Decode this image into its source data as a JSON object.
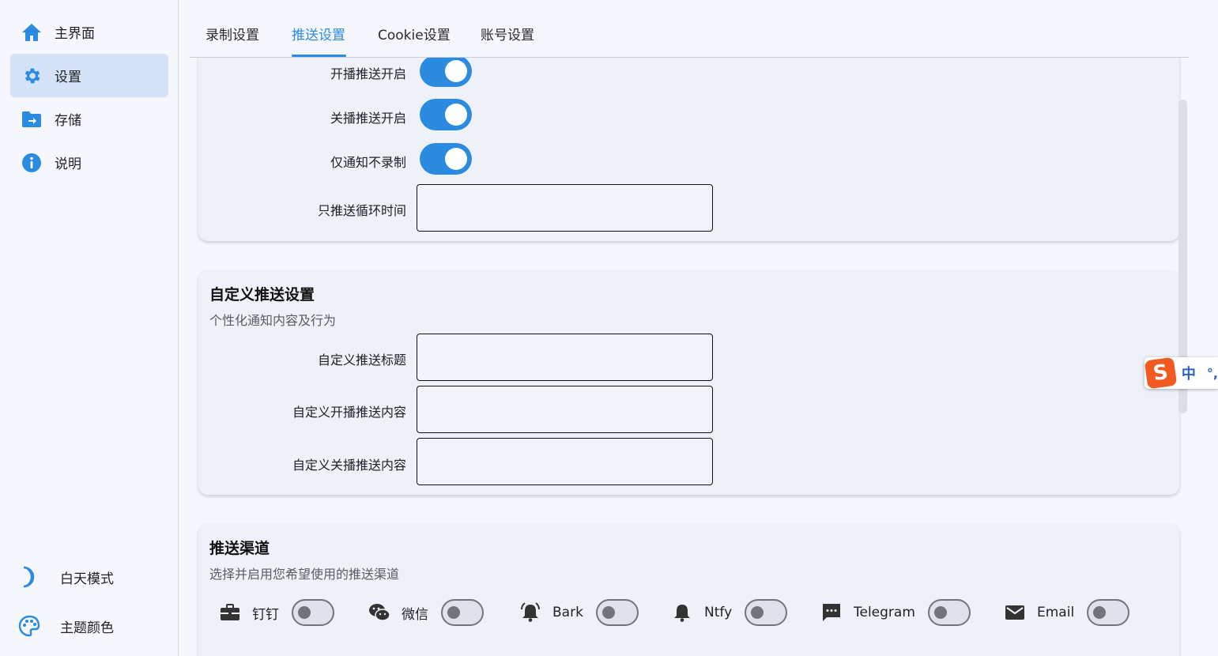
{
  "sidebar": {
    "items": [
      {
        "label": "主界面",
        "icon": "home-icon"
      },
      {
        "label": "设置",
        "icon": "gear-icon"
      },
      {
        "label": "存储",
        "icon": "folder-arrow-icon"
      },
      {
        "label": "说明",
        "icon": "info-icon"
      }
    ],
    "bottom": [
      {
        "label": "白天模式",
        "icon": "moon-icon"
      },
      {
        "label": "主题颜色",
        "icon": "palette-icon"
      }
    ]
  },
  "tabs": [
    "录制设置",
    "推送设置",
    "Cookie设置",
    "账号设置"
  ],
  "push_card": {
    "rows": [
      {
        "label": "开播推送开启",
        "value": true
      },
      {
        "label": "关播推送开启",
        "value": true
      },
      {
        "label": "仅通知不录制",
        "value": true
      }
    ],
    "loop_label": "只推送循环时间",
    "loop_value": ""
  },
  "custom_card": {
    "title": "自定义推送设置",
    "subtitle": "个性化通知内容及行为",
    "fields": [
      {
        "label": "自定义推送标题",
        "value": ""
      },
      {
        "label": "自定义开播推送内容",
        "value": ""
      },
      {
        "label": "自定义关播推送内容",
        "value": ""
      }
    ]
  },
  "channel_card": {
    "title": "推送渠道",
    "subtitle": "选择并启用您希望使用的推送渠道",
    "channels": [
      {
        "label": "钉钉",
        "icon": "briefcase-icon",
        "enabled": false
      },
      {
        "label": "微信",
        "icon": "wechat-icon",
        "enabled": false
      },
      {
        "label": "Bark",
        "icon": "bell-ring-icon",
        "enabled": false
      },
      {
        "label": "Ntfy",
        "icon": "bell-icon",
        "enabled": false
      },
      {
        "label": "Telegram",
        "icon": "chat-icon",
        "enabled": false
      },
      {
        "label": "Email",
        "icon": "mail-icon",
        "enabled": false
      }
    ]
  },
  "ime": {
    "mode": "中",
    "punct": "°,"
  },
  "colors": {
    "accent": "#2b8be0",
    "active_nav": "#d3e2f7",
    "card": "#eff1f8"
  }
}
